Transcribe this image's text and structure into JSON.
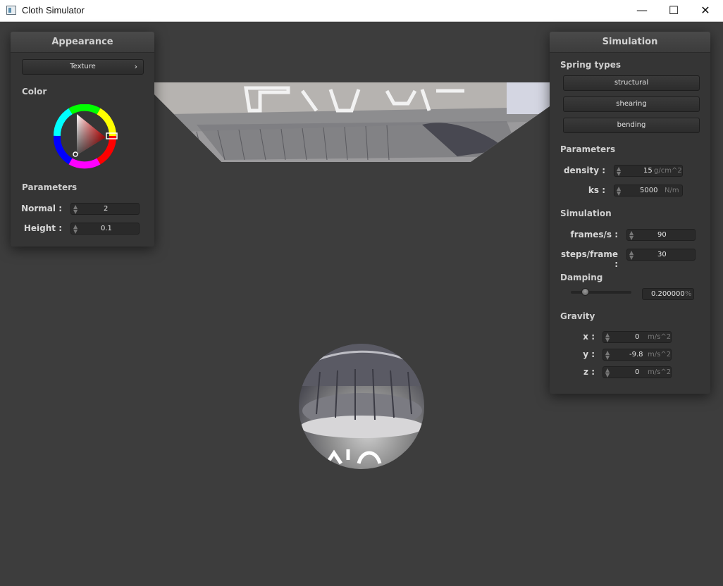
{
  "window": {
    "title": "Cloth Simulator",
    "minimize_glyph": "—",
    "maximize_glyph": "☐",
    "close_glyph": "✕"
  },
  "appearance_panel": {
    "header": "Appearance",
    "texture_button": "Texture",
    "texture_chevron": "›",
    "color_label": "Color",
    "color_selected": "#cc0000",
    "parameters_label": "Parameters",
    "normal": {
      "label": "Normal :",
      "value": "2"
    },
    "height": {
      "label": "Height :",
      "value": "0.1"
    }
  },
  "simulation_panel": {
    "header": "Simulation",
    "spring_types_label": "Spring types",
    "spring_buttons": [
      "structural",
      "shearing",
      "bending"
    ],
    "parameters_label": "Parameters",
    "density": {
      "label": "density :",
      "value": "15",
      "unit": "g/cm^2"
    },
    "ks": {
      "label": "ks :",
      "value": "5000",
      "unit": "N/m"
    },
    "simulation_label": "Simulation",
    "frames_per_s": {
      "label": "frames/s :",
      "value": "90"
    },
    "steps_per_frame": {
      "label": "steps/frame :",
      "value": "30"
    },
    "damping_label": "Damping",
    "damping": {
      "value": "0.200000",
      "unit": "%",
      "slider_fraction": 0.2
    },
    "gravity_label": "Gravity",
    "gravity_x": {
      "label": "x :",
      "value": "0",
      "unit": "m/s^2"
    },
    "gravity_y": {
      "label": "y :",
      "value": "-9.8",
      "unit": "m/s^2"
    },
    "gravity_z": {
      "label": "z :",
      "value": "0",
      "unit": "m/s^2"
    }
  }
}
